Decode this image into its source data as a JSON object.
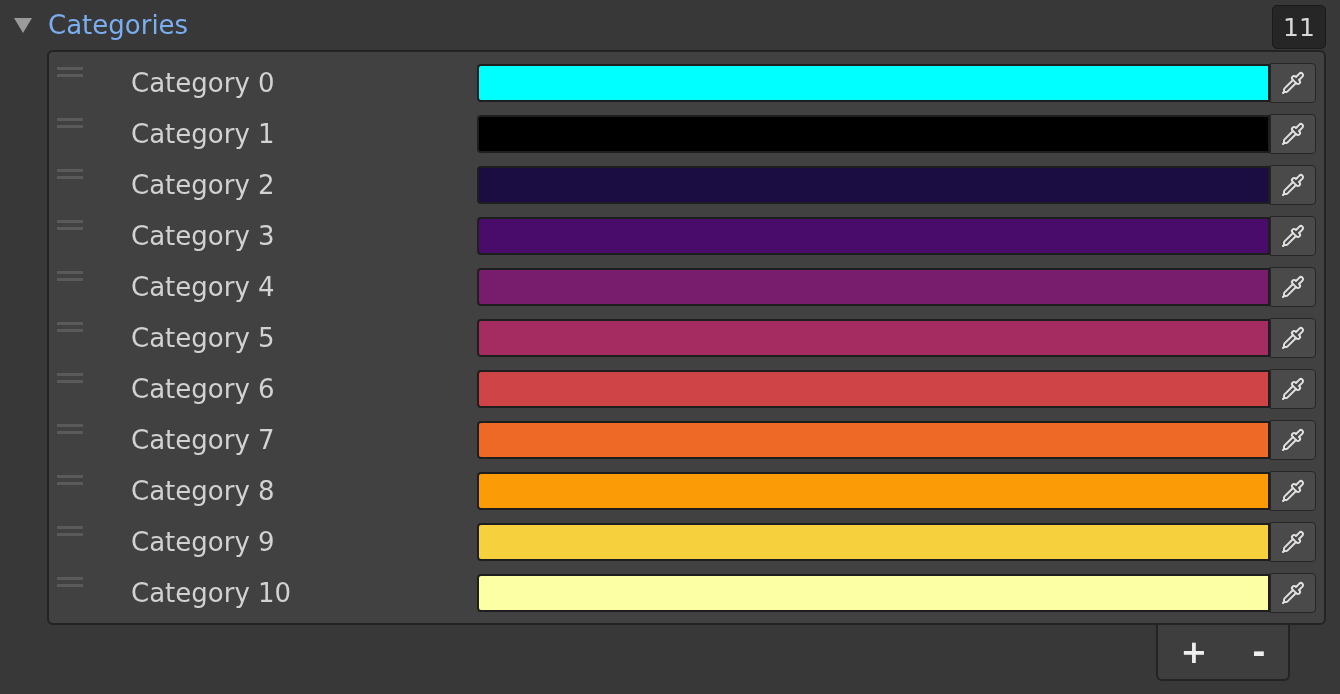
{
  "section": {
    "title": "Categories",
    "expanded": true,
    "count": "11"
  },
  "items": [
    {
      "label": "Category 0",
      "color": "#00ffff"
    },
    {
      "label": "Category 1",
      "color": "#000000"
    },
    {
      "label": "Category 2",
      "color": "#1b0c41"
    },
    {
      "label": "Category 3",
      "color": "#4a0c6b"
    },
    {
      "label": "Category 4",
      "color": "#781c6d"
    },
    {
      "label": "Category 5",
      "color": "#a52c60"
    },
    {
      "label": "Category 6",
      "color": "#cf4446"
    },
    {
      "label": "Category 7",
      "color": "#ed6925"
    },
    {
      "label": "Category 8",
      "color": "#fb9b06"
    },
    {
      "label": "Category 9",
      "color": "#f7d13d"
    },
    {
      "label": "Category 10",
      "color": "#fcffa4"
    }
  ],
  "footer_buttons": [
    "+",
    "-"
  ]
}
